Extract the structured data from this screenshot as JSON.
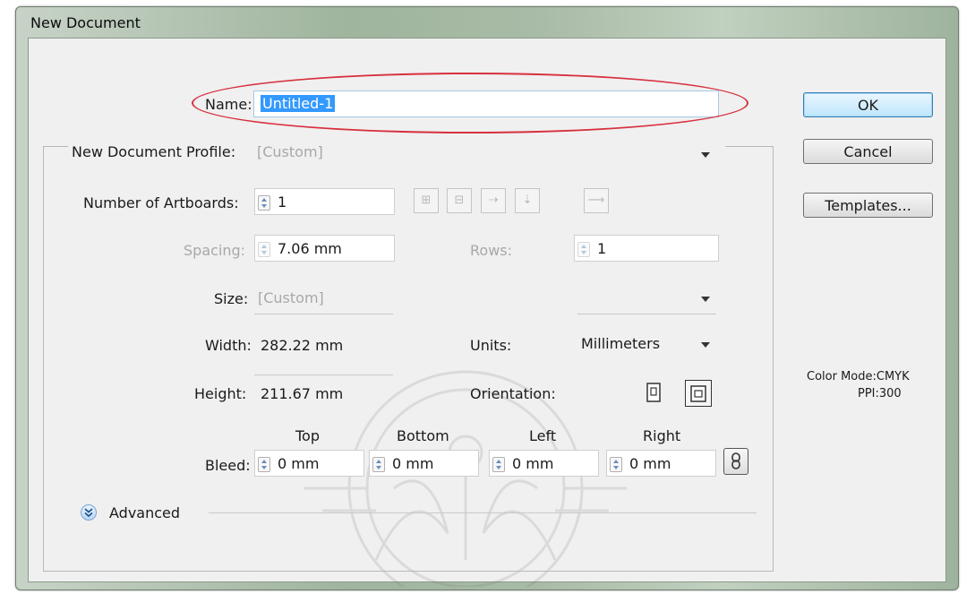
{
  "window": {
    "title": "New Document"
  },
  "name_label": "Name:",
  "name_value": "Untitled-1",
  "profile": {
    "label": "New Document Profile:",
    "value": "[Custom]"
  },
  "artboards": {
    "label": "Number of Artboards:",
    "value": "1"
  },
  "spacing": {
    "label": "Spacing:",
    "value": "7.06 mm"
  },
  "rows": {
    "label": "Rows:",
    "value": "1"
  },
  "size": {
    "label": "Size:",
    "value": "[Custom]"
  },
  "width": {
    "label": "Width:",
    "value": "282.22 mm"
  },
  "units": {
    "label": "Units:",
    "value": "Millimeters"
  },
  "height": {
    "label": "Height:",
    "value": "211.67 mm"
  },
  "orientation": {
    "label": "Orientation:"
  },
  "bleed": {
    "label": "Bleed:",
    "top": {
      "label": "Top",
      "value": "0 mm"
    },
    "bottom": {
      "label": "Bottom",
      "value": "0 mm"
    },
    "left": {
      "label": "Left",
      "value": "0 mm"
    },
    "right": {
      "label": "Right",
      "value": "0 mm"
    }
  },
  "advanced": {
    "label": "Advanced"
  },
  "buttons": {
    "ok": "OK",
    "cancel": "Cancel",
    "templates": "Templates..."
  },
  "color_info": {
    "mode": "Color Mode:CMYK",
    "ppi": "PPI:300"
  }
}
